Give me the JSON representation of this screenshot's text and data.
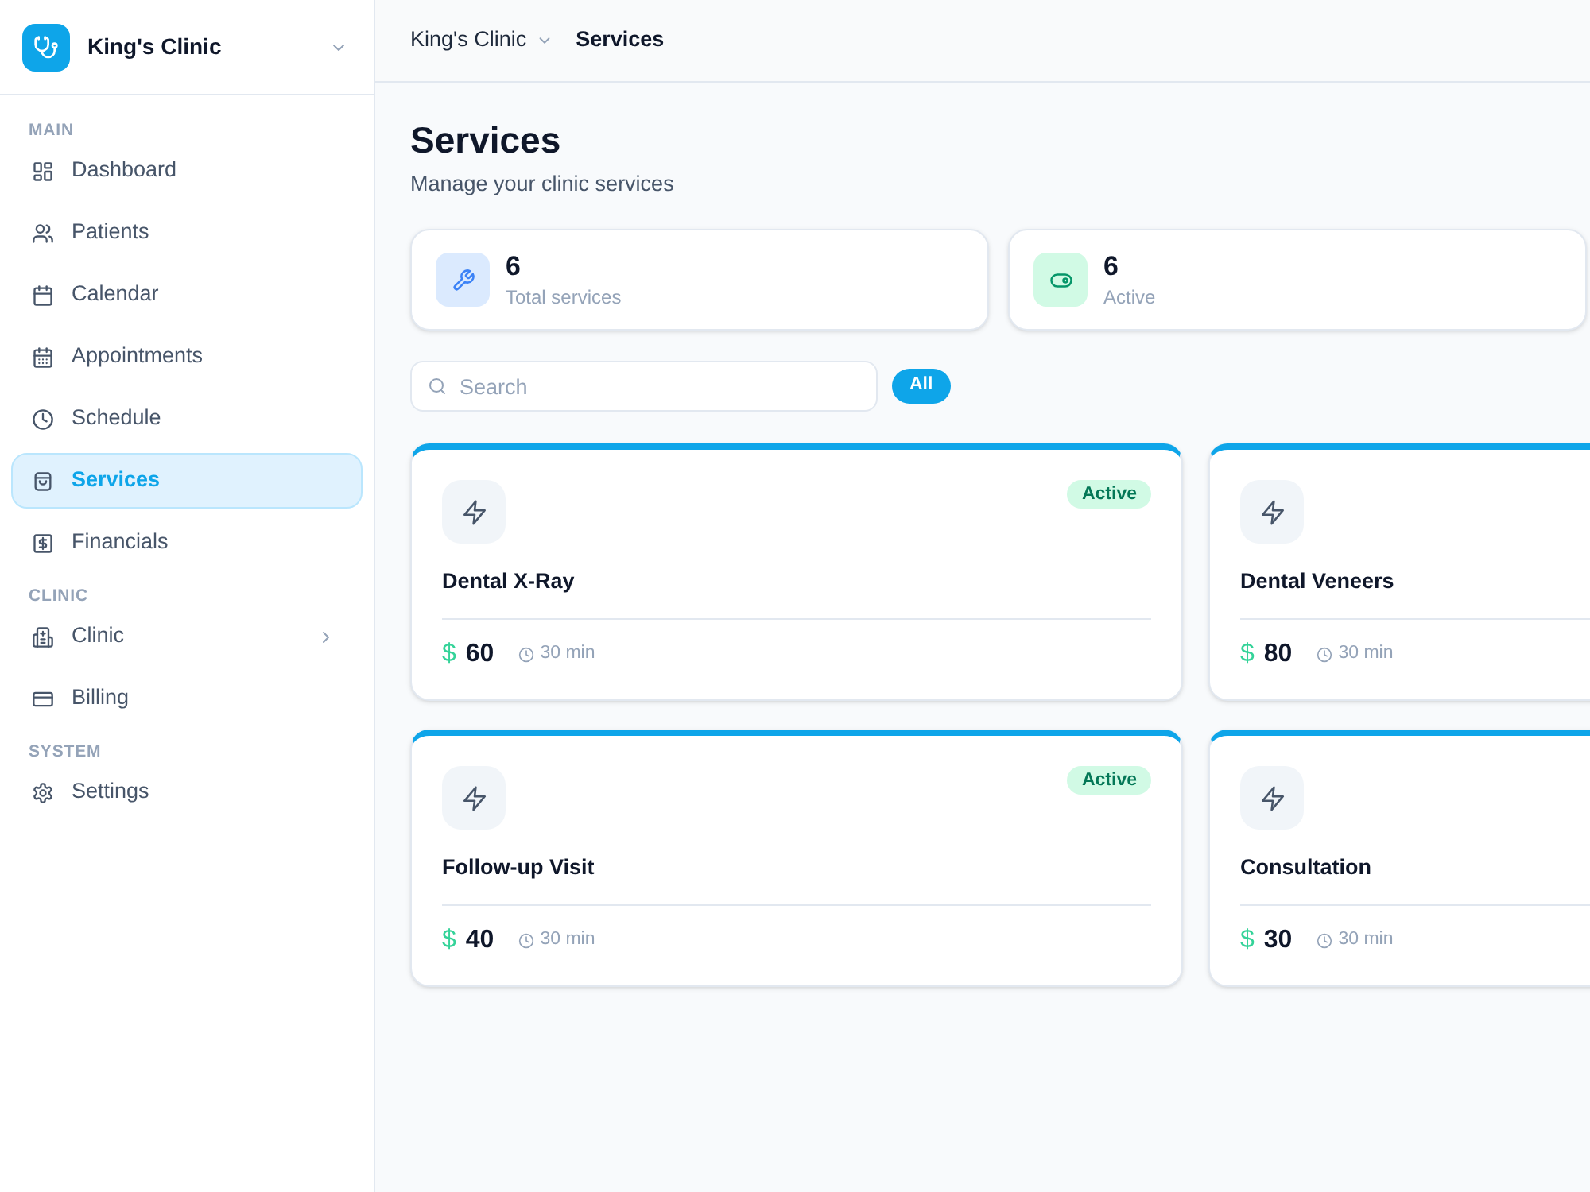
{
  "sidebar": {
    "brand": {
      "name": "King's Clinic"
    },
    "sections": [
      {
        "label": "MAIN",
        "items": [
          {
            "label": "Dashboard",
            "kind": "link",
            "selected": false
          },
          {
            "label": "Patients",
            "kind": "link",
            "selected": false
          },
          {
            "label": "Calendar",
            "kind": "link",
            "selected": false
          },
          {
            "label": "Appointments",
            "kind": "link",
            "selected": false
          },
          {
            "label": "Schedule",
            "kind": "link",
            "selected": false
          },
          {
            "label": "Services",
            "kind": "link",
            "selected": true
          },
          {
            "label": "Financials",
            "kind": "link",
            "selected": false
          }
        ]
      },
      {
        "label": "CLINIC",
        "items": [
          {
            "label": "Clinic",
            "kind": "group",
            "expanded": false,
            "selected": false
          },
          {
            "label": "Billing",
            "kind": "link",
            "selected": false
          }
        ]
      },
      {
        "label": "SYSTEM",
        "items": [
          {
            "label": "Settings",
            "kind": "link",
            "selected": false
          }
        ]
      }
    ]
  },
  "breadcrumb": [
    {
      "label": "King's Clinic",
      "kind": "dropdown"
    },
    {
      "label": "Services",
      "kind": "current"
    }
  ],
  "page": {
    "title": "Services",
    "subtitle": "Manage your clinic services"
  },
  "stats": [
    {
      "value": "6",
      "label": "Total services"
    },
    {
      "value": "6",
      "label": "Active"
    }
  ],
  "search": {
    "placeholder": "Search"
  },
  "filters": [
    {
      "label": "All",
      "selected": true
    }
  ],
  "services": [
    {
      "name": "Dental X-Ray",
      "currency": "$",
      "price": "60",
      "duration": "30 min",
      "status": "Active"
    },
    {
      "name": "Dental Veneers",
      "currency": "$",
      "price": "80",
      "duration": "30 min"
    },
    {
      "name": "Follow-up Visit",
      "currency": "$",
      "price": "40",
      "duration": "30 min",
      "status": "Active"
    },
    {
      "name": "Consultation",
      "currency": "$",
      "price": "30",
      "duration": "30 min"
    }
  ]
}
